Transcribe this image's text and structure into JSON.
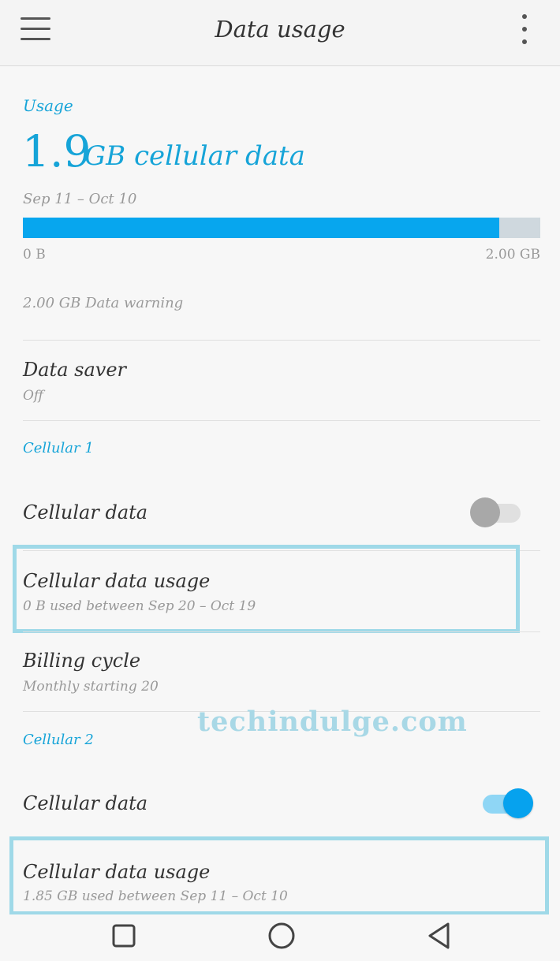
{
  "header": {
    "title": "Data usage",
    "menu_icon": "hamburger-menu-icon",
    "more_icon": "more-vertical-icon"
  },
  "usage": {
    "label": "Usage",
    "amount": "1.9",
    "unit": "GB cellular data",
    "period": "Sep 11 – Oct 10",
    "fraction_used": 0.92,
    "bar_min": "0 B",
    "bar_max": "2.00 GB",
    "warning": "2.00 GB Data warning"
  },
  "data_saver": {
    "title": "Data saver",
    "status": "Off"
  },
  "cellular1": {
    "section": "Cellular 1",
    "cellular_data_label": "Cellular data",
    "cellular_data_on": false,
    "usage_title": "Cellular data usage",
    "usage_sub": "0 B used between Sep 20 – Oct 19",
    "billing_title": "Billing cycle",
    "billing_sub": "Monthly starting 20"
  },
  "cellular2": {
    "section": "Cellular 2",
    "cellular_data_label": "Cellular data",
    "cellular_data_on": true,
    "usage_title": "Cellular data usage",
    "usage_sub": "1.85 GB used between Sep 11 – Oct 10"
  },
  "watermark": "techindulge.com",
  "nav": {
    "recents_icon": "square-recents-icon",
    "home_icon": "circle-home-icon",
    "back_icon": "triangle-back-icon"
  },
  "colors": {
    "accent": "#16a4d8",
    "bar_fill": "#07a6ee",
    "highlight": "#9fd9e8"
  }
}
